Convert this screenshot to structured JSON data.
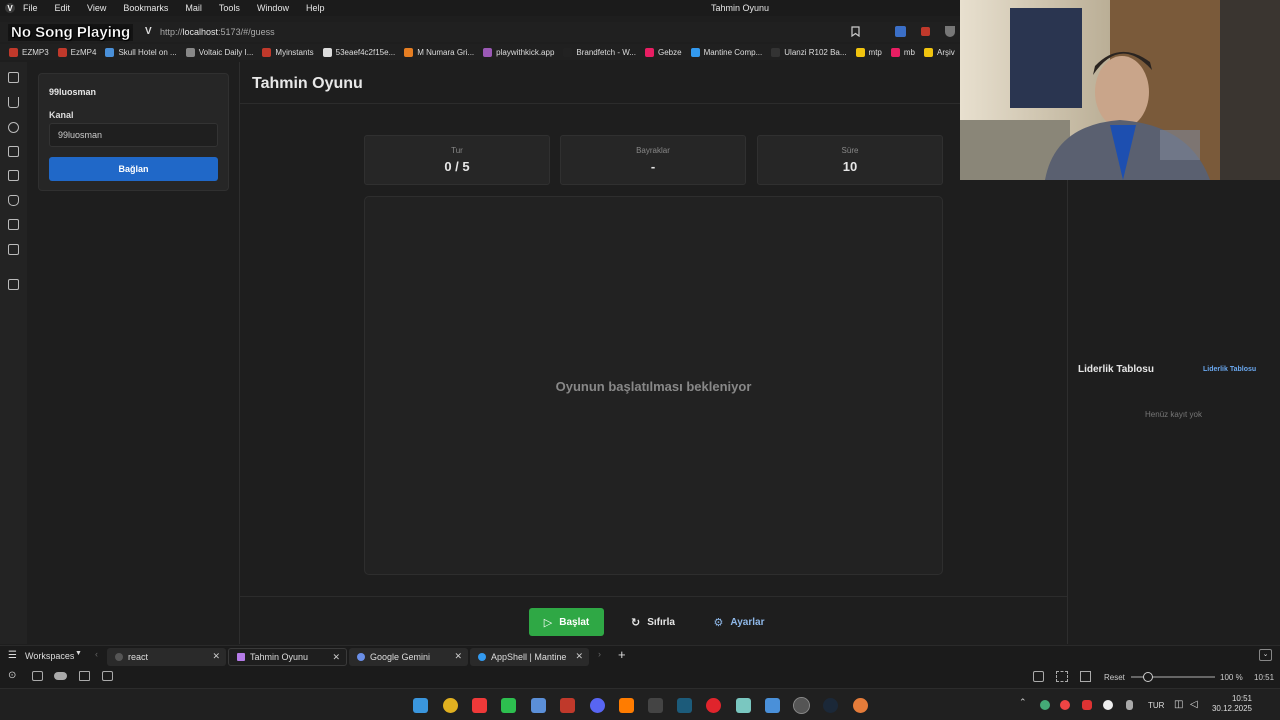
{
  "menubar": {
    "items": [
      "File",
      "Edit",
      "View",
      "Bookmarks",
      "Mail",
      "Tools",
      "Window",
      "Help"
    ],
    "window_title": "Tahmin Oyunu"
  },
  "overlay": {
    "now_playing": "No Song Playing"
  },
  "address": {
    "url_prefix": "http://",
    "url_host": "localhost",
    "url_rest": ":5173/#/guess"
  },
  "bookmarks": [
    {
      "label": "EZMP3",
      "color": "#c0392b"
    },
    {
      "label": "EzMP4",
      "color": "#c0392b"
    },
    {
      "label": "Skull Hotel on ...",
      "color": "#4a90d9"
    },
    {
      "label": "Voltaic Daily I...",
      "color": "#888888"
    },
    {
      "label": "Myinstants",
      "color": "#c0392b"
    },
    {
      "label": "53eaef4c2f15e...",
      "color": "#dddddd"
    },
    {
      "label": "M Numara Gri...",
      "color": "#e67e22"
    },
    {
      "label": "playwithkick.app",
      "color": "#9b59b6"
    },
    {
      "label": "Brandfetch - W...",
      "color": "#222222"
    },
    {
      "label": "Gebze",
      "color": "#e91e63"
    },
    {
      "label": "Mantine Comp...",
      "color": "#339af0"
    },
    {
      "label": "Ulanzi R102 Ba...",
      "color": "#333333"
    },
    {
      "label": "mtp",
      "color": "#f1c40f"
    },
    {
      "label": "mb",
      "color": "#e91e63"
    },
    {
      "label": "Arşiv",
      "color": "#f1c40f"
    }
  ],
  "left_panel": {
    "card_title": "99luosman",
    "channel_label": "Kanal",
    "channel_value": "99luosman",
    "connect_label": "Bağlan"
  },
  "main": {
    "title": "Tahmin Oyunu",
    "stats": [
      {
        "label": "Tur",
        "value": "0 / 5"
      },
      {
        "label": "Bayraklar",
        "value": "-"
      },
      {
        "label": "Süre",
        "value": "10"
      }
    ],
    "waiting_text": "Oyunun başlatılması bekleniyor",
    "buttons": {
      "start": "Başlat",
      "reset": "Sıfırla",
      "settings": "Ayarlar"
    }
  },
  "leaderboard": {
    "title": "Liderlik Tablosu",
    "link": "Liderlik Tablosu",
    "empty": "Henüz kayıt yok"
  },
  "tabbar": {
    "workspaces": "Workspaces",
    "tabs": [
      {
        "label": "react",
        "active": false
      },
      {
        "label": "Tahmin Oyunu",
        "active": true
      },
      {
        "label": "Google Gemini",
        "active": false
      },
      {
        "label": "AppShell | Mantine",
        "active": false
      }
    ]
  },
  "statusbar": {
    "reset": "Reset",
    "zoom": "100 %",
    "time": "10:51"
  },
  "taskbar": {
    "lang": "TUR",
    "clock_time": "10:51",
    "clock_date": "30.12.2025"
  }
}
